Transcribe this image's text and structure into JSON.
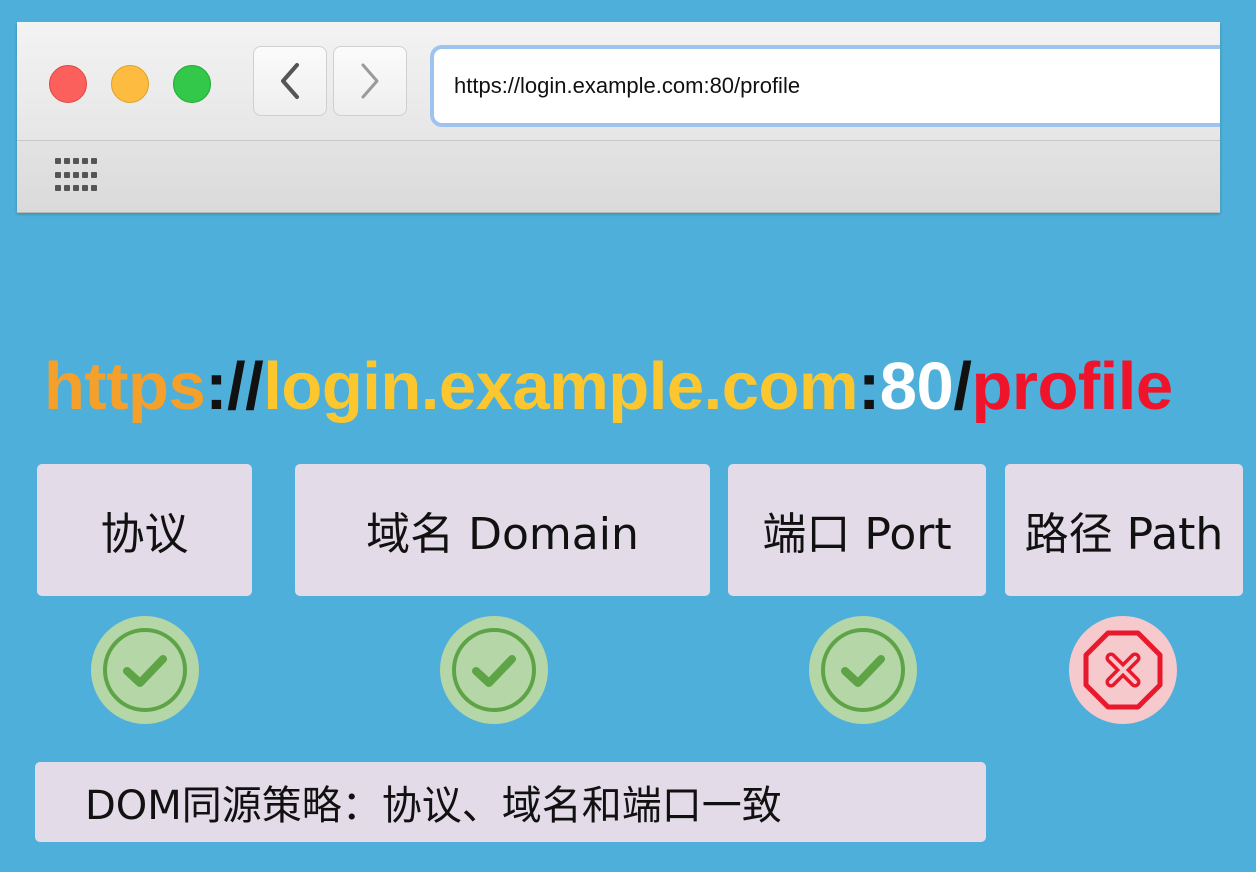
{
  "browser": {
    "url": "https://login.example.com:80/profile",
    "icons": {
      "close": "traffic-light-red",
      "minimize": "traffic-light-yellow",
      "maximize": "traffic-light-green",
      "back": "chevron-left-icon",
      "forward": "chevron-right-icon",
      "apps": "grid-icon"
    }
  },
  "url_parts": {
    "protocol": "https",
    "sep1": "://",
    "domain": "login.example.com",
    "sep2": ":",
    "port": "80",
    "sep3": "/",
    "path": "profile"
  },
  "colors": {
    "background": "#4eb0da",
    "protocol": "#f4a02a",
    "domain": "#fcc72e",
    "separator": "#111111",
    "port": "#ffffff",
    "path": "#f0142a",
    "ok_fill": "#b5d6a7",
    "ok_stroke": "#5ea447",
    "fail_fill": "#f6c9cc",
    "fail_stroke": "#e8192c"
  },
  "labels": {
    "protocol": "协议",
    "domain": "域名 Domain",
    "port": "端口 Port",
    "path": "路径 Path"
  },
  "checks": {
    "protocol": "match",
    "domain": "match",
    "port": "match",
    "path": "mismatch"
  },
  "policy_text": "DOM同源策略：协议、域名和端口一致"
}
